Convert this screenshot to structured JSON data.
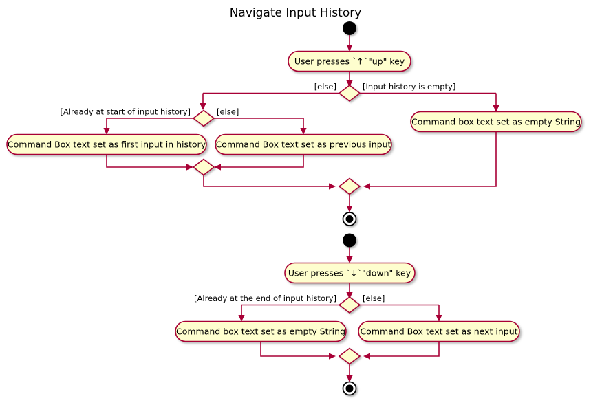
{
  "diagram": {
    "title": "Navigate Input History",
    "type": "activity-diagram",
    "colors": {
      "node_fill": "#FEFECE",
      "node_border": "#A80036",
      "edge": "#A80036",
      "terminal": "#000000",
      "background": "#FFFFFF"
    }
  },
  "flow_up": {
    "start_node": "start",
    "trigger": "User presses `↑`\"up\" key",
    "decision_outer": {
      "guard_left": "[else]",
      "guard_right": "[Input history is empty]"
    },
    "decision_inner": {
      "guard_left": "[Already at start of input history]",
      "guard_right": "[else]"
    },
    "activities": {
      "first_input": "Command Box text set as first input in history",
      "previous_input": "Command Box text set as previous input",
      "empty_string": "Command box text set as empty String"
    },
    "end_node": "end"
  },
  "flow_down": {
    "start_node": "start",
    "trigger": "User presses `↓`\"down\" key",
    "decision": {
      "guard_left": "[Already at the end of input history]",
      "guard_right": "[else]"
    },
    "activities": {
      "empty_string": "Command box text set as empty String",
      "next_input": "Command Box text set as next input"
    },
    "end_node": "end"
  }
}
